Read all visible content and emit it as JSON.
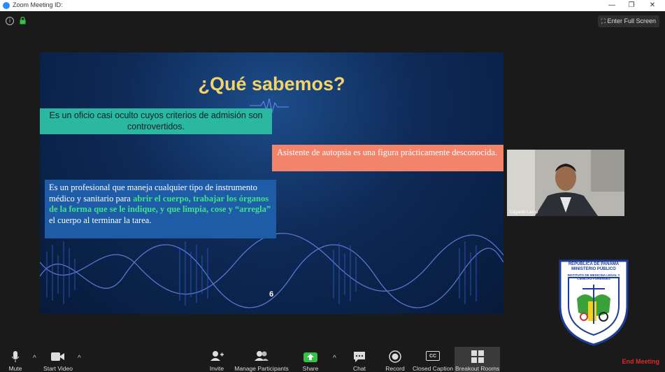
{
  "window": {
    "title": "Zoom Meeting ID:",
    "minimize": "—",
    "restore": "❐",
    "close": "✕"
  },
  "topbar": {
    "info": "i",
    "fullscreen_label": "Enter Full Screen"
  },
  "slide": {
    "title": "¿Qué sabemos?",
    "box1": "Es un oficio casi oculto cuyos criterios de admisión son controvertidos.",
    "box2": "Asistente de autopsia es una figura prácticamente desconocida.",
    "box3": {
      "part1": "Es un profesional que maneja cualquier tipo de instrumento médico y sanitario para ",
      "highlight": "abrir el cuerpo, trabajar los órganos de la forma que se le indique, y que limpia, cose y “arregla”",
      "part2": " el cuerpo al terminar la tarea."
    },
    "page_number": "6",
    "colors": {
      "title": "#f3d36a",
      "teal": "#2bb8a3",
      "salmon": "#f3846c",
      "blue": "#1f5ca8",
      "highlight": "#3ee28a"
    }
  },
  "participant": {
    "name": "Edgardo Lasso"
  },
  "logo": {
    "top_text": "REPÚBLICA DE PANAMÁ",
    "sub_text": "MINISTERIO PÚBLICO",
    "ring_text": "INSTITUTO DE MEDICINA LEGAL Y CIENCIAS FORENSES"
  },
  "toolbar": {
    "mute": "Mute",
    "start_video": "Start Video",
    "invite": "Invite",
    "manage_participants": "Manage Participants",
    "share": "Share",
    "chat": "Chat",
    "record": "Record",
    "closed_caption": "Closed Caption",
    "cc_icon_text": "CC",
    "breakout_rooms": "Breakout Rooms",
    "end_meeting": "End Meeting",
    "caret": "^"
  }
}
